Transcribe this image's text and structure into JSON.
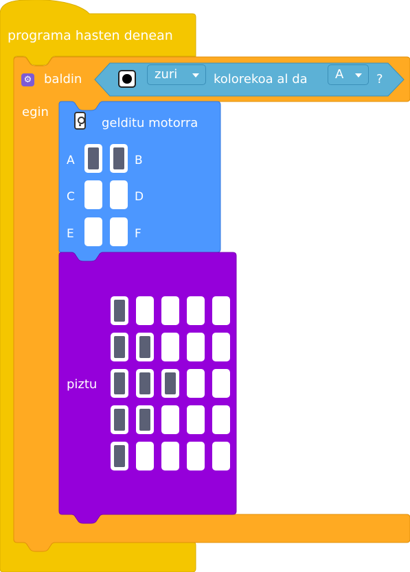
{
  "colors": {
    "event": "#f4c600",
    "control": "#ffaa22",
    "sensor": "#5cb1d6",
    "motor": "#4c97ff",
    "display": "#9500da",
    "led_on": "#5b6075",
    "led_off": "#ffffff"
  },
  "hat": {
    "label": "programa hasten denean"
  },
  "if_block": {
    "keyword": "baldin",
    "do_label": "egin",
    "icon": "gear-icon"
  },
  "sensor": {
    "icon": "color-sensor-icon",
    "color_value": "zuri",
    "text": "kolorekoa al da",
    "port_value": "A",
    "suffix": "?"
  },
  "motor_stop": {
    "label": "gelditu motorra",
    "icon": "remote-icon",
    "ports": [
      {
        "left": "A",
        "right": "B",
        "left_on": true,
        "right_on": true
      },
      {
        "left": "C",
        "right": "D",
        "left_on": false,
        "right_on": false
      },
      {
        "left": "E",
        "right": "F",
        "left_on": false,
        "right_on": false
      }
    ]
  },
  "light": {
    "label": "piztu",
    "matrix": [
      [
        1,
        0,
        0,
        0,
        0
      ],
      [
        1,
        1,
        0,
        0,
        0
      ],
      [
        1,
        1,
        1,
        0,
        0
      ],
      [
        1,
        1,
        0,
        0,
        0
      ],
      [
        1,
        0,
        0,
        0,
        0
      ]
    ]
  }
}
